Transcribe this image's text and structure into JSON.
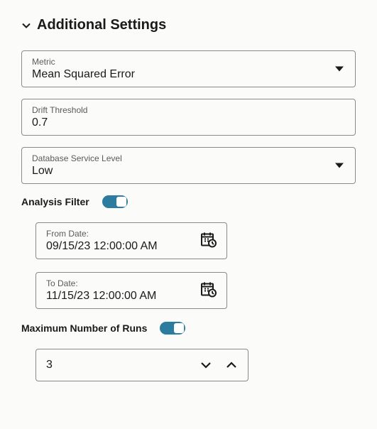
{
  "header": {
    "title": "Additional Settings"
  },
  "fields": {
    "metric": {
      "label": "Metric",
      "value": "Mean Squared Error"
    },
    "drift": {
      "label": "Drift Threshold",
      "value": "0.7"
    },
    "service": {
      "label": "Database Service Level",
      "value": "Low"
    }
  },
  "analysisFilter": {
    "label": "Analysis Filter",
    "enabled": true,
    "fromDate": {
      "label": "From Date:",
      "value": "09/15/23 12:00:00 AM"
    },
    "toDate": {
      "label": "To Date:",
      "value": "11/15/23 12:00:00 AM"
    }
  },
  "maxRuns": {
    "label": "Maximum Number of Runs",
    "enabled": true,
    "value": "3"
  }
}
